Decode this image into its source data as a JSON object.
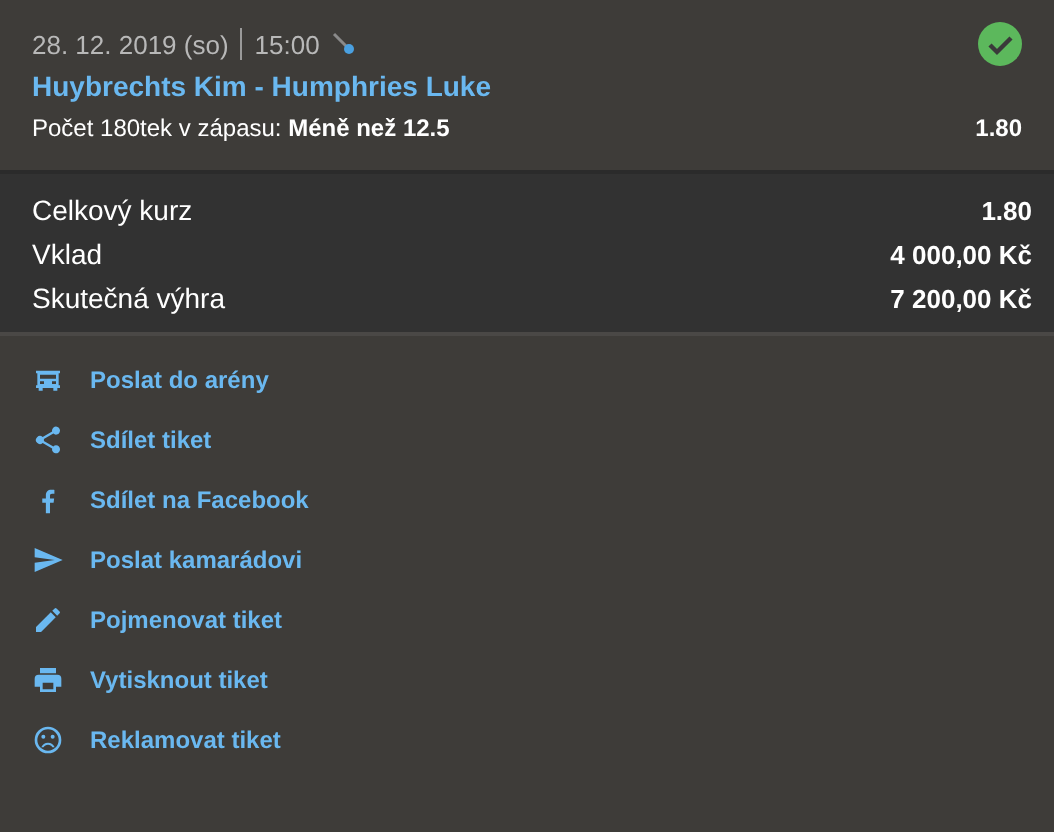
{
  "event": {
    "date": "28. 12. 2019 (so)",
    "time": "15:00",
    "won": true,
    "match": "Huybrechts Kim - Humphries Luke",
    "selection": "Počet 180tek v zápasu: **Méně než 12.5**",
    "odds": "1.80"
  },
  "summary": [
    {
      "label": "Celkový kurz",
      "value": "1.80"
    },
    {
      "label": "Vklad",
      "value": "4 000,00 Kč"
    },
    {
      "label": "Skutečná výhra",
      "value": "7 200,00 Kč"
    }
  ],
  "actions": [
    {
      "kind": "arena",
      "label": "Poslat do arény"
    },
    {
      "kind": "share",
      "label": "Sdílet tiket"
    },
    {
      "kind": "facebook",
      "label": "Sdílet na Facebook"
    },
    {
      "kind": "send",
      "label": "Poslat kamarádovi"
    },
    {
      "kind": "rename",
      "label": "Pojmenovat tiket"
    },
    {
      "kind": "print",
      "label": "Vytisknout tiket"
    },
    {
      "kind": "complain",
      "label": "Reklamovat tiket"
    }
  ]
}
